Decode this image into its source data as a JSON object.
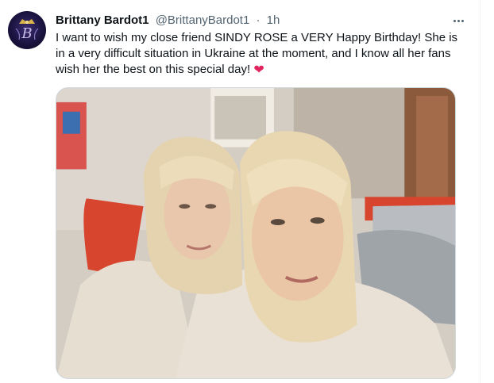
{
  "tweet": {
    "author_name": "Brittany Bardot1",
    "author_handle": "@BrittanyBardot1",
    "separator": "·",
    "time": "1h",
    "text": "I want to wish my close friend SINDY ROSE a VERY Happy Birthday! She is in a very difficult situation in Ukraine at the moment, and I know all her fans wish her the best on this special day!",
    "heart": "❤",
    "more_icon": "more-horizontal-icon",
    "avatar_letter": "B"
  },
  "colors": {
    "text_primary": "#0f1419",
    "text_secondary": "#536471",
    "heart": "#e0245e",
    "border": "#cfd9de"
  }
}
